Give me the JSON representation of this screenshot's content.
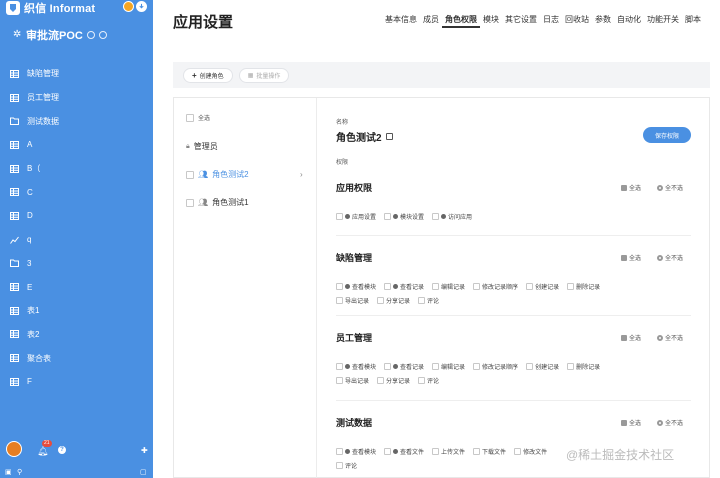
{
  "brand": {
    "name": "织信 Informat"
  },
  "app": {
    "name": "审批流POC"
  },
  "nav": [
    {
      "label": "缺陷管理",
      "icon": "table-icon"
    },
    {
      "label": "员工管理",
      "icon": "table-icon"
    },
    {
      "label": "测试数据",
      "icon": "folder-icon"
    },
    {
      "label": "A",
      "icon": "table-icon"
    },
    {
      "label": "B（",
      "icon": "table-icon"
    },
    {
      "label": "C",
      "icon": "table-icon"
    },
    {
      "label": "D",
      "icon": "table-icon"
    },
    {
      "label": "q",
      "icon": "chart-icon"
    },
    {
      "label": "3",
      "icon": "folder-icon"
    },
    {
      "label": "E",
      "icon": "table-icon"
    },
    {
      "label": "表1",
      "icon": "table-icon"
    },
    {
      "label": "表2",
      "icon": "table-icon"
    },
    {
      "label": "聚合表",
      "icon": "table-icon"
    },
    {
      "label": "F",
      "icon": "table-icon"
    }
  ],
  "notifications": {
    "count": "21"
  },
  "page": {
    "title": "应用设置"
  },
  "tabs": [
    "基本信息",
    "成员",
    "角色权限",
    "模块",
    "其它设置",
    "日志",
    "回收站",
    "参数",
    "自动化",
    "功能开关",
    "脚本"
  ],
  "toolbar": {
    "create_role": "创建角色",
    "batch_ops": "批量操作"
  },
  "roles": {
    "select_all": "全选",
    "items": [
      "管理员",
      "角色测试2",
      "角色测试1"
    ]
  },
  "detail": {
    "name_label": "名称",
    "role_name": "角色测试2",
    "save_label": "保存权限",
    "perm_label": "权限",
    "select_all": "全选",
    "select_none": "全不选",
    "sections": [
      {
        "title": "应用权限",
        "rows": [
          [
            "应用设置",
            "模块设置",
            "访问应用"
          ]
        ]
      },
      {
        "title": "缺陷管理",
        "rows": [
          [
            "查看模块",
            "查看记录",
            "编辑记录",
            "修改记录顺序",
            "创建记录",
            "删除记录"
          ],
          [
            "导出记录",
            "分享记录",
            "评论"
          ]
        ]
      },
      {
        "title": "员工管理",
        "rows": [
          [
            "查看模块",
            "查看记录",
            "编辑记录",
            "修改记录顺序",
            "创建记录",
            "删除记录"
          ],
          [
            "导出记录",
            "分享记录",
            "评论"
          ]
        ]
      },
      {
        "title": "测试数据",
        "rows": [
          [
            "查看模块",
            "查看文件",
            "上传文件",
            "下载文件",
            "修改文件"
          ],
          [
            "评论"
          ]
        ]
      }
    ]
  },
  "watermark": "@稀土掘金技术社区"
}
